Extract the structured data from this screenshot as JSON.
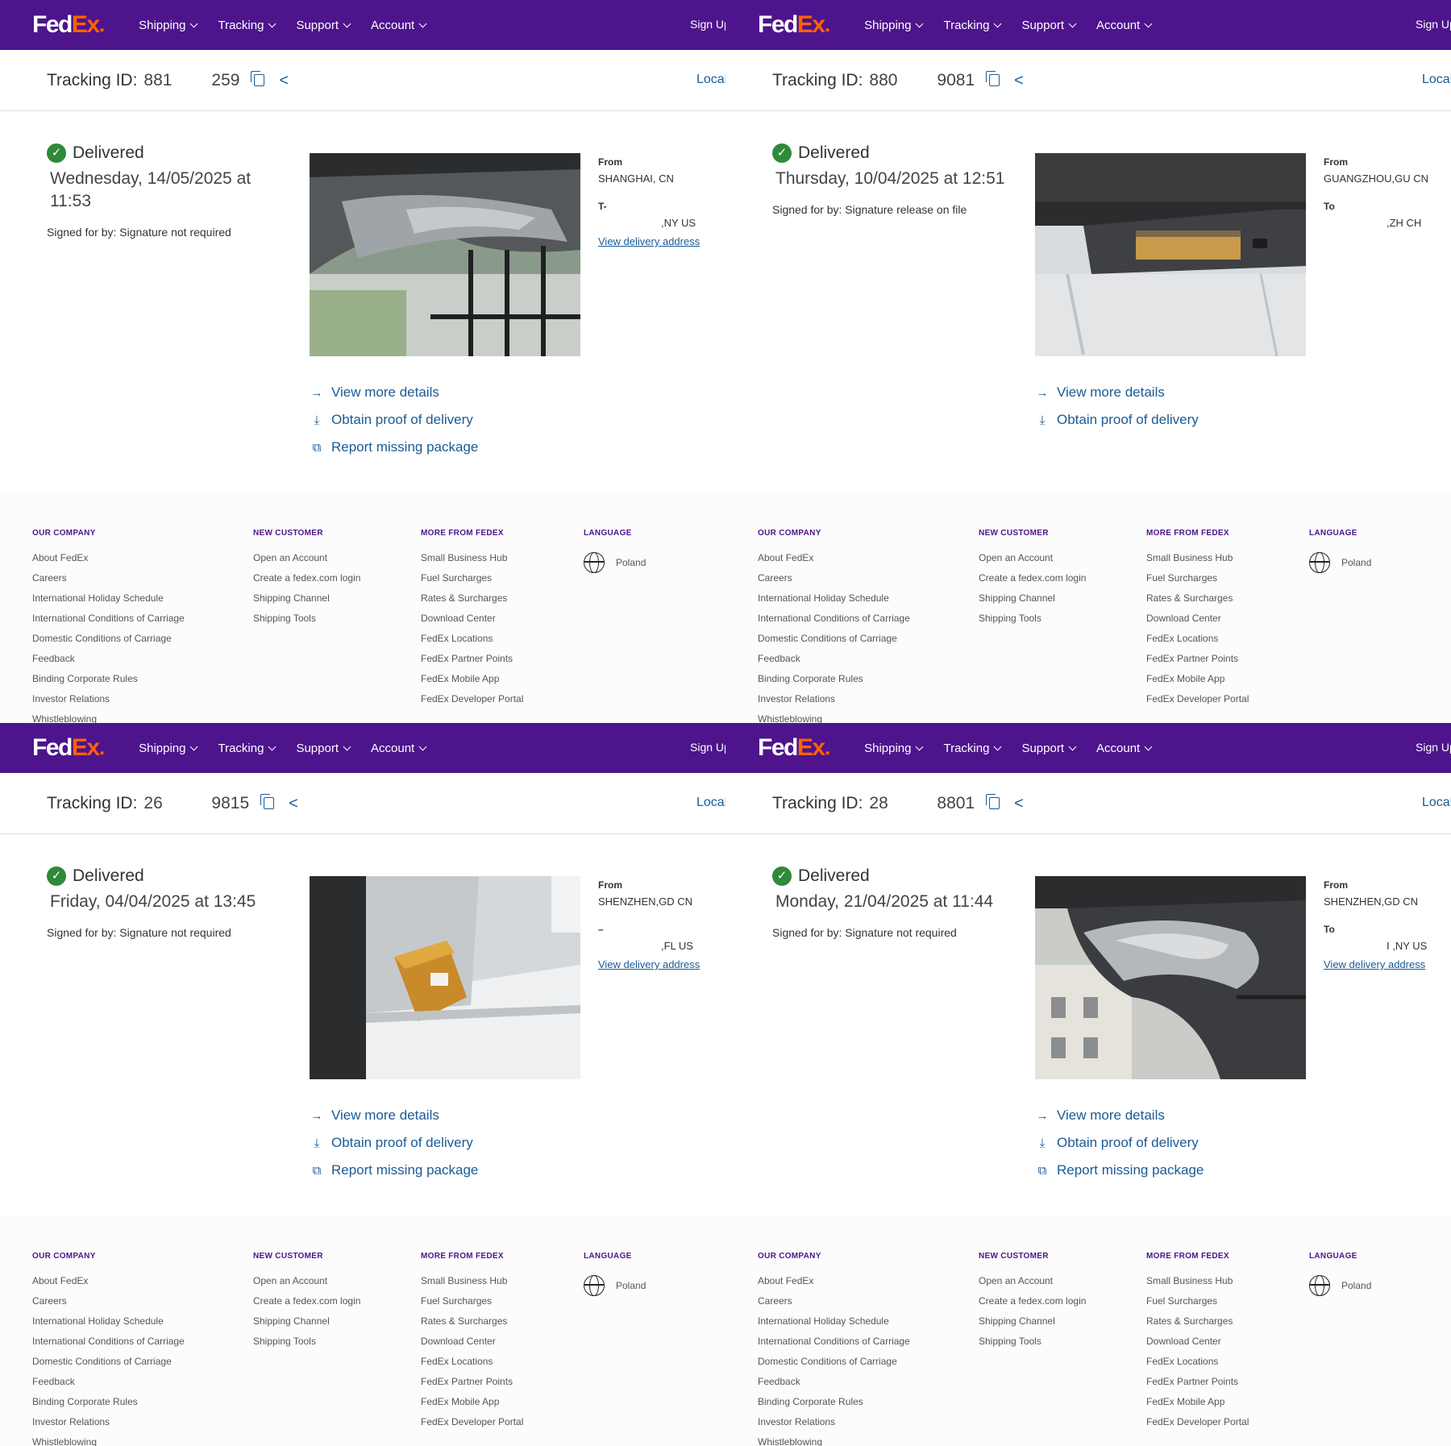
{
  "nav": {
    "logo_fed": "Fed",
    "logo_ex": "Ex",
    "items": [
      "Shipping",
      "Tracking",
      "Support",
      "Account"
    ],
    "signup": "Sign Up/L"
  },
  "track_label": "Tracking ID:",
  "local_label": "Local",
  "actions": {
    "view_more": "View more details",
    "proof": "Obtain proof of delivery",
    "report": "Report missing package"
  },
  "address_labels": {
    "from": "From",
    "to": "To",
    "view": "View delivery address"
  },
  "panels": [
    {
      "tid_a": "881",
      "tid_b": "259",
      "status": "Delivered",
      "date": "Wednesday, 14/05/2025 at 11:53",
      "signed": "Signed for by: Signature not required",
      "from_city": "SHANGHAI, CN",
      "to_label": "T-",
      "to_city": ",NY US",
      "photo": "awning"
    },
    {
      "tid_a": "880",
      "tid_b": "9081",
      "status": "Delivered",
      "date": "Thursday, 10/04/2025 at 12:51",
      "signed": "Signed for by: Signature release on file",
      "from_city": "GUANGZHOU,GU CN",
      "to_label": "To",
      "to_city": ",ZH CH",
      "photo": "mailbox"
    },
    {
      "tid_a": "26",
      "tid_b": "9815",
      "status": "Delivered",
      "date": "Friday, 04/04/2025 at 13:45",
      "signed": "Signed for by: Signature not required",
      "from_city": "SHENZHEN,GD CN",
      "to_label": "–",
      "to_city": ",FL US",
      "photo": "box"
    },
    {
      "tid_a": "28",
      "tid_b": "8801",
      "status": "Delivered",
      "date": "Monday, 21/04/2025 at 11:44",
      "signed": "Signed for by: Signature not required",
      "from_city": "SHENZHEN,GD CN",
      "to_label": "To",
      "to_city": "I        ,NY US",
      "photo": "awning2"
    }
  ],
  "footer": {
    "our_company": {
      "title": "OUR COMPANY",
      "links": [
        "About FedEx",
        "Careers",
        "International Holiday Schedule",
        "International Conditions of Carriage",
        "Domestic Conditions of Carriage",
        "Feedback",
        "Binding Corporate Rules",
        "Investor Relations",
        "Whistleblowing"
      ]
    },
    "new_customer": {
      "title": "NEW CUSTOMER",
      "links": [
        "Open an Account",
        "Create a fedex.com login",
        "Shipping Channel",
        "Shipping Tools"
      ]
    },
    "more_from_fedex": {
      "title": "MORE FROM FEDEX",
      "links": [
        "Small Business Hub",
        "Fuel Surcharges",
        "Rates & Surcharges",
        "Download Center",
        "FedEx Locations",
        "FedEx Partner Points",
        "FedEx Mobile App",
        "FedEx Developer Portal"
      ]
    },
    "language": {
      "title": "LANGUAGE",
      "value": "Poland"
    }
  },
  "colors": {
    "brand_purple": "#4d148c",
    "brand_orange": "#ff6200",
    "link_blue": "#1a5a96",
    "success_green": "#2f8a3a"
  }
}
